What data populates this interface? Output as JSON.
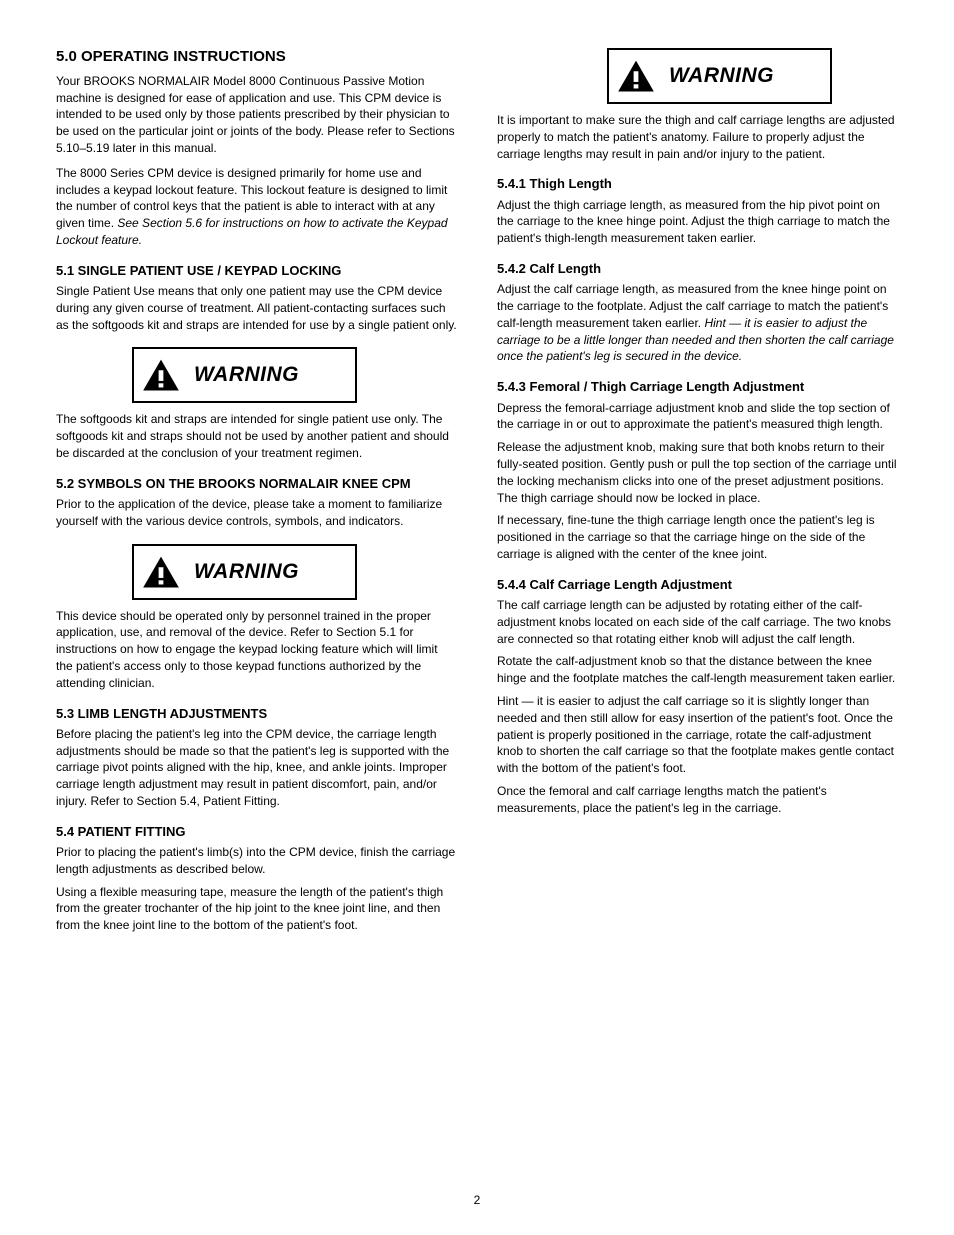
{
  "left": {
    "title": "5.0 OPERATING INSTRUCTIONS",
    "para1": "Your BROOKS NORMALAIR Model 8000 Continuous Passive Motion machine is designed for ease of application and use.  This CPM device is intended to be used only by those patients prescribed by their physician to be used on the particular joint or joints of the body.  Please refer to Sections 5.10–5.19 later in this manual.",
    "para2_part1": "The 8000 Series CPM device is designed primarily for home use and includes a keypad lockout feature.  This lockout feature is designed to limit the number of control keys that the patient is able to interact with at any given time.",
    "para2_part2_italic": "See Section 5.6 for instructions on how to activate the Keypad Lockout feature.",
    "sub1_title": "5.1 SINGLE PATIENT USE / KEYPAD LOCKING",
    "sub1_para": "Single Patient Use means that only one patient may use the CPM device during any given course of treatment.  All patient-contacting surfaces such as the softgoods kit and straps are intended for use by a single patient only.",
    "warn1_label": "WARNING",
    "warn1_para": "The softgoods kit and straps are intended for single patient use only.  The softgoods kit and straps should not be used by another patient and should be discarded at the conclusion of your treatment regimen.",
    "sub2_title": "5.2 SYMBOLS ON THE BROOKS NORMALAIR KNEE CPM",
    "sub2_para": "Prior to the application of the device, please take a moment to familiarize yourself with the various device controls, symbols, and indicators.",
    "warn2_label": "WARNING",
    "warn2_para": "This device should be operated only by personnel trained in the proper application, use, and removal of the device.  Refer to Section 5.1 for instructions on how to engage the keypad locking feature which will limit the patient's access only to those keypad functions authorized by the attending clinician.",
    "sub3_title": "5.3 LIMB LENGTH ADJUSTMENTS",
    "sub3_para": "Before placing the patient's leg into the CPM device, the carriage length adjustments should be made so that the patient's leg is supported with the carriage pivot points aligned with the hip, knee, and ankle joints.  Improper carriage length adjustment may result in patient discomfort, pain, and/or injury.  Refer to Section 5.4, Patient Fitting.",
    "sub4_title": "5.4 PATIENT FITTING",
    "sub4_para1": "Prior to placing the patient's limb(s) into the CPM device, finish the carriage length adjustments as described below.",
    "sub4_para2": "Using a flexible measuring tape, measure the length of the patient's thigh from the greater trochanter of the hip joint to the knee joint line, and then from the knee joint line to the bottom of the patient's foot."
  },
  "right": {
    "warn_label": "WARNING",
    "warn_para": "It is important to make sure the thigh and calf carriage lengths are adjusted properly to match the patient's anatomy.  Failure to properly adjust the carriage lengths may result in pain and/or injury to the patient.",
    "r1_title": "5.4.1 Thigh Length",
    "r1_para": "Adjust the thigh carriage length, as measured from the hip pivot point on the carriage to the knee hinge point.  Adjust the thigh carriage to match the patient's thigh-length measurement taken earlier.",
    "r2_title": "5.4.2 Calf Length",
    "r2_part1": "Adjust the calf carriage length, as measured from the knee hinge point on the carriage to the footplate.  Adjust the calf carriage to match the patient's calf-length measurement taken earlier.",
    "r2_part2_italic": "Hint — it is easier to adjust the carriage to be a little longer than needed and then shorten the calf carriage once the patient's leg is secured in the device.",
    "r3_title": "5.4.3 Femoral / Thigh Carriage Length Adjustment",
    "r3_p1": "Depress the femoral-carriage adjustment knob and slide the top section of the carriage in or out to approximate the patient's measured thigh length.",
    "r3_p2": "Release the adjustment knob, making sure that both knobs return to their fully-seated position.  Gently push or pull the top section of the carriage until the locking mechanism clicks into one of the preset adjustment positions.  The thigh carriage should now be locked in place.",
    "r3_p3": "If necessary, fine-tune the thigh carriage length once the patient's leg is positioned in the carriage so that the carriage hinge on the side of the carriage is aligned with the center of the knee joint.",
    "r4_title": "5.4.4 Calf Carriage Length Adjustment",
    "r4_p1": "The calf carriage length can be adjusted by rotating either of the calf-adjustment knobs located on each side of the calf carriage.  The two knobs are connected so that rotating either knob will adjust the calf length.",
    "r4_p2": "Rotate the calf-adjustment knob so that the distance between the knee hinge and the footplate matches the calf-length measurement taken earlier.",
    "r4_p3": "Hint — it is easier to adjust the calf carriage so it is slightly longer than needed and then still allow for easy insertion of the patient's foot.  Once the patient is properly positioned in the carriage, rotate the calf-adjustment knob to shorten the calf carriage so that the footplate makes gentle contact with the bottom of the patient's foot.",
    "r4_p4": "Once the femoral and calf carriage lengths match the patient's measurements, place the patient's leg in the carriage."
  },
  "page_number": "2"
}
